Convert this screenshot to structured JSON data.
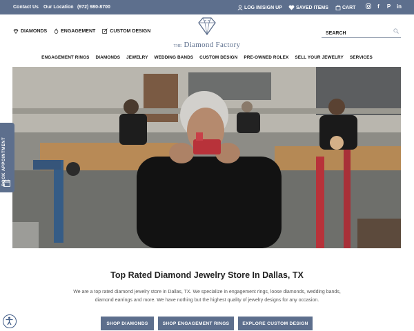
{
  "topbar": {
    "contact": "Contact Us",
    "location": "Our Location",
    "phone": "(972) 980-8700",
    "login": "LOG IN/SIGN UP",
    "saved": "SAVED ITEMS",
    "cart": "CART",
    "social": [
      "instagram-icon",
      "facebook-icon",
      "pinterest-icon",
      "linkedin-icon"
    ]
  },
  "header": {
    "links": [
      "DIAMONDS",
      "ENGAGEMENT",
      "CUSTOM DESIGN"
    ],
    "logo_prefix": "THE",
    "logo_name": "Diamond Factory",
    "search_placeholder": "SEARCH"
  },
  "nav": [
    "ENGAGEMENT RINGS",
    "DIAMONDS",
    "JEWELRY",
    "WEDDING BANDS",
    "CUSTOM DESIGN",
    "PRE-OWNED ROLEX",
    "SELL YOUR JEWELRY",
    "SERVICES"
  ],
  "book_appointment": "BOOK APPOINTMENT",
  "content": {
    "headline": "Top Rated Diamond Jewelry Store In Dallas, TX",
    "intro": "We are a top rated diamond jewelry store in Dallas, TX. We specialize in engagement rings, loose diamonds, wedding bands, diamond earrings and more. We have nothing but the highest quality of jewelry designs for any occasion.",
    "buttons": [
      "SHOP DIAMONDS",
      "SHOP ENGAGEMENT RINGS",
      "EXPLORE CUSTOM DESIGN"
    ]
  },
  "colors": {
    "brand": "#5d6f8d",
    "text": "#222222"
  }
}
